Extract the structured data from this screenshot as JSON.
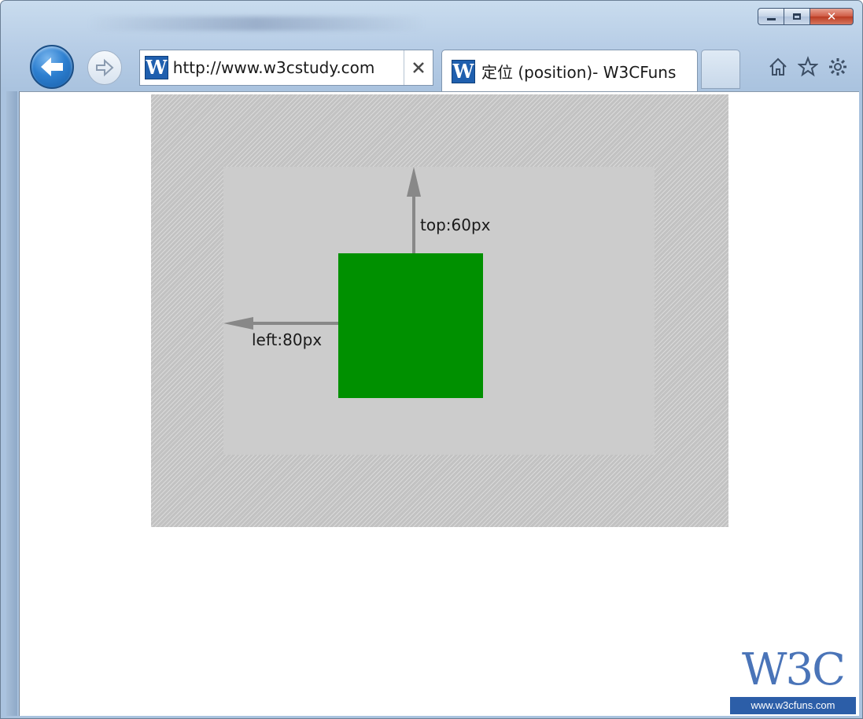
{
  "browser": {
    "address": "http://www.w3cstudy.com",
    "favicon_letter": "W",
    "tab_title": "定位 (position)- W3CFuns",
    "caption": {
      "minimize": "minimize-icon",
      "maximize": "maximize-icon",
      "close": "✕"
    },
    "icons": [
      "back-arrow-icon",
      "forward-arrow-icon",
      "home-icon",
      "star-icon",
      "gear-icon"
    ]
  },
  "page": {
    "top_label": "top:60px",
    "left_label": "left:80px",
    "colors": {
      "target_box": "#009000",
      "container": "#cccccc",
      "arrow": "#888888"
    }
  },
  "watermark": {
    "logo": "W3C",
    "url": "www.w3cfuns.com"
  }
}
